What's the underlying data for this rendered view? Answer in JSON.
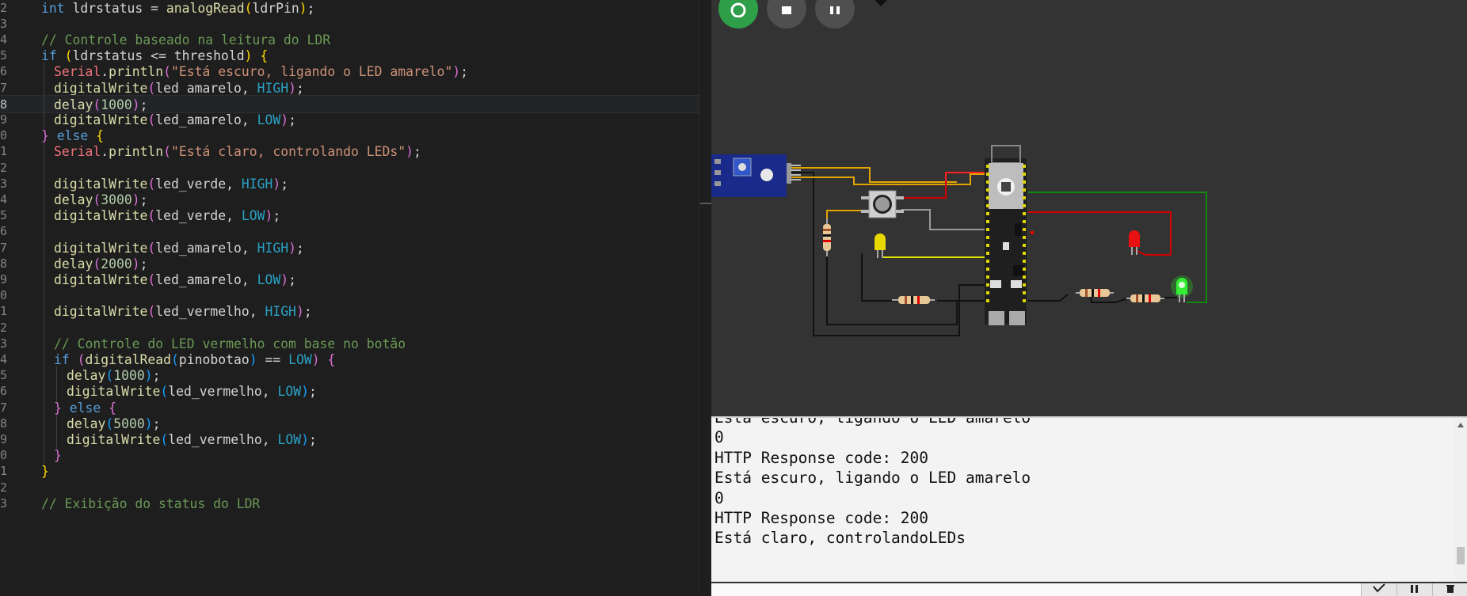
{
  "editor": {
    "lines": [
      {
        "ln": "2",
        "segs": [
          [
            "int ",
            "kw"
          ],
          [
            "ldrstatus ",
            "vr"
          ],
          [
            "= ",
            "op"
          ],
          [
            "analogRead",
            "fn"
          ],
          [
            "(",
            "b1"
          ],
          [
            "ldrPin",
            "vr"
          ],
          [
            ")",
            "b1"
          ],
          [
            ";",
            "op"
          ]
        ]
      },
      {
        "ln": "3",
        "segs": []
      },
      {
        "ln": "4",
        "segs": [
          [
            "// Controle baseado na leitura do LDR",
            "cm"
          ]
        ]
      },
      {
        "ln": "5",
        "segs": [
          [
            "if ",
            "kw"
          ],
          [
            "(",
            "b1"
          ],
          [
            "ldrstatus ",
            "vr"
          ],
          [
            "<= ",
            "op"
          ],
          [
            "threshold",
            "vr"
          ],
          [
            ") ",
            "b1"
          ],
          [
            "{",
            "b1"
          ]
        ]
      },
      {
        "ln": "6",
        "segs": [
          [
            "Serial",
            "obj"
          ],
          [
            ".",
            "op"
          ],
          [
            "println",
            "fn"
          ],
          [
            "(",
            "b2"
          ],
          [
            "\"Está escuro, ligando o LED amarelo\"",
            "st"
          ],
          [
            ")",
            "b2"
          ],
          [
            ";",
            "op"
          ]
        ]
      },
      {
        "ln": "7",
        "segs": [
          [
            "digitalWrite",
            "fn"
          ],
          [
            "(",
            "b2"
          ],
          [
            "led_amarelo, ",
            "vr"
          ],
          [
            "HIGH",
            "ct"
          ],
          [
            ")",
            "b2"
          ],
          [
            ";",
            "op"
          ]
        ]
      },
      {
        "ln": "8",
        "segs": [
          [
            "delay",
            "fn"
          ],
          [
            "(",
            "b2"
          ],
          [
            "1000",
            "nm"
          ],
          [
            ")",
            "b2"
          ],
          [
            ";",
            "op"
          ]
        ],
        "current": true
      },
      {
        "ln": "9",
        "segs": [
          [
            "digitalWrite",
            "fn"
          ],
          [
            "(",
            "b2"
          ],
          [
            "led_amarelo, ",
            "vr"
          ],
          [
            "LOW",
            "ct"
          ],
          [
            ")",
            "b2"
          ],
          [
            ";",
            "op"
          ]
        ]
      },
      {
        "ln": "0",
        "segs": [
          [
            "} ",
            "b2"
          ],
          [
            "else ",
            "kw"
          ],
          [
            "{",
            "b1"
          ]
        ]
      },
      {
        "ln": "1",
        "segs": [
          [
            "Serial",
            "obj"
          ],
          [
            ".",
            "op"
          ],
          [
            "println",
            "fn"
          ],
          [
            "(",
            "b2"
          ],
          [
            "\"Está claro, controlando LEDs\"",
            "st"
          ],
          [
            ")",
            "b2"
          ],
          [
            ";",
            "op"
          ]
        ]
      },
      {
        "ln": "2",
        "segs": []
      },
      {
        "ln": "3",
        "segs": [
          [
            "digitalWrite",
            "fn"
          ],
          [
            "(",
            "b2"
          ],
          [
            "led_verde, ",
            "vr"
          ],
          [
            "HIGH",
            "ct"
          ],
          [
            ")",
            "b2"
          ],
          [
            ";",
            "op"
          ]
        ]
      },
      {
        "ln": "4",
        "segs": [
          [
            "delay",
            "fn"
          ],
          [
            "(",
            "b2"
          ],
          [
            "3000",
            "nm"
          ],
          [
            ")",
            "b2"
          ],
          [
            ";",
            "op"
          ]
        ]
      },
      {
        "ln": "5",
        "segs": [
          [
            "digitalWrite",
            "fn"
          ],
          [
            "(",
            "b2"
          ],
          [
            "led_verde, ",
            "vr"
          ],
          [
            "LOW",
            "ct"
          ],
          [
            ")",
            "b2"
          ],
          [
            ";",
            "op"
          ]
        ]
      },
      {
        "ln": "6",
        "segs": []
      },
      {
        "ln": "7",
        "segs": [
          [
            "digitalWrite",
            "fn"
          ],
          [
            "(",
            "b2"
          ],
          [
            "led_amarelo, ",
            "vr"
          ],
          [
            "HIGH",
            "ct"
          ],
          [
            ")",
            "b2"
          ],
          [
            ";",
            "op"
          ]
        ]
      },
      {
        "ln": "8",
        "segs": [
          [
            "delay",
            "fn"
          ],
          [
            "(",
            "b2"
          ],
          [
            "2000",
            "nm"
          ],
          [
            ")",
            "b2"
          ],
          [
            ";",
            "op"
          ]
        ]
      },
      {
        "ln": "9",
        "segs": [
          [
            "digitalWrite",
            "fn"
          ],
          [
            "(",
            "b2"
          ],
          [
            "led_amarelo, ",
            "vr"
          ],
          [
            "LOW",
            "ct"
          ],
          [
            ")",
            "b2"
          ],
          [
            ";",
            "op"
          ]
        ]
      },
      {
        "ln": "0",
        "segs": []
      },
      {
        "ln": "1",
        "segs": [
          [
            "digitalWrite",
            "fn"
          ],
          [
            "(",
            "b2"
          ],
          [
            "led_vermelho, ",
            "vr"
          ],
          [
            "HIGH",
            "ct"
          ],
          [
            ")",
            "b2"
          ],
          [
            ";",
            "op"
          ]
        ]
      },
      {
        "ln": "2",
        "segs": []
      },
      {
        "ln": "3",
        "segs": [
          [
            "// Controle do LED vermelho com base no botão",
            "cm"
          ]
        ]
      },
      {
        "ln": "4",
        "segs": [
          [
            "if ",
            "kw"
          ],
          [
            "(",
            "b2"
          ],
          [
            "digitalRead",
            "fn"
          ],
          [
            "(",
            "b3"
          ],
          [
            "pinobotao",
            "vr"
          ],
          [
            ")",
            "b3"
          ],
          [
            " == ",
            "op"
          ],
          [
            "LOW",
            "ct"
          ],
          [
            ") ",
            "b2"
          ],
          [
            "{",
            "b2"
          ]
        ]
      },
      {
        "ln": "5",
        "segs": [
          [
            "delay",
            "fn"
          ],
          [
            "(",
            "b3"
          ],
          [
            "1000",
            "nm"
          ],
          [
            ")",
            "b3"
          ],
          [
            ";",
            "op"
          ]
        ]
      },
      {
        "ln": "6",
        "segs": [
          [
            "digitalWrite",
            "fn"
          ],
          [
            "(",
            "b3"
          ],
          [
            "led_vermelho, ",
            "vr"
          ],
          [
            "LOW",
            "ct"
          ],
          [
            ")",
            "b3"
          ],
          [
            ";",
            "op"
          ]
        ]
      },
      {
        "ln": "7",
        "segs": [
          [
            "} ",
            "b2"
          ],
          [
            "else ",
            "kw"
          ],
          [
            "{",
            "b2"
          ]
        ]
      },
      {
        "ln": "8",
        "segs": [
          [
            "delay",
            "fn"
          ],
          [
            "(",
            "b3"
          ],
          [
            "5000",
            "nm"
          ],
          [
            ")",
            "b3"
          ],
          [
            ";",
            "op"
          ]
        ]
      },
      {
        "ln": "9",
        "segs": [
          [
            "digitalWrite",
            "fn"
          ],
          [
            "(",
            "b3"
          ],
          [
            "led_vermelho, ",
            "vr"
          ],
          [
            "LOW",
            "ct"
          ],
          [
            ")",
            "b3"
          ],
          [
            ";",
            "op"
          ]
        ]
      },
      {
        "ln": "0",
        "segs": [
          [
            "}",
            "b2"
          ]
        ]
      },
      {
        "ln": "1",
        "segs": [
          [
            "}",
            "b1"
          ]
        ]
      },
      {
        "ln": "2",
        "segs": []
      },
      {
        "ln": "3",
        "segs": [
          [
            "// Exibição do status do LDR",
            "cm"
          ]
        ]
      }
    ],
    "indents": [
      0,
      0,
      0,
      0,
      1,
      1,
      1,
      1,
      0,
      1,
      1,
      1,
      1,
      1,
      1,
      1,
      1,
      1,
      1,
      1,
      1,
      1,
      1,
      2,
      2,
      1,
      2,
      2,
      1,
      0,
      0,
      0
    ]
  },
  "simulator": {
    "toolbar": {
      "start_label": "start simulation",
      "stop_label": "stop simulation",
      "pause_label": "pause simulation"
    },
    "colors": {
      "start": "#2e9e48",
      "stop": "#4f4f4f",
      "canvas": "#333333"
    }
  },
  "serial_monitor": {
    "lines": [
      "Está escuro, ligando o LED amarelo",
      "0",
      "HTTP Response code: 200",
      "Está escuro, ligando o LED amarelo",
      "0",
      "HTTP Response code: 200",
      "Está claro, controlandoLEDs"
    ]
  }
}
